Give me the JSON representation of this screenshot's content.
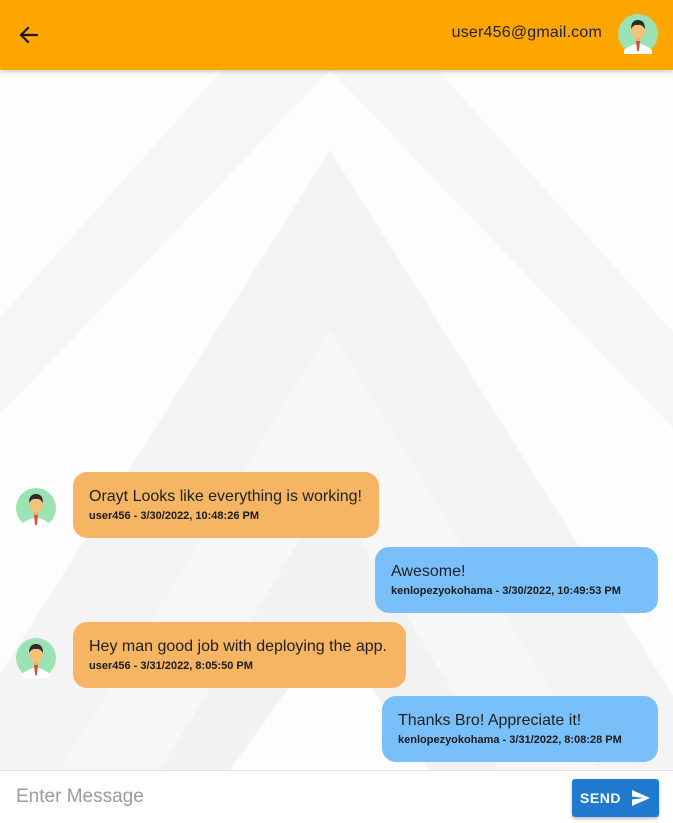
{
  "header": {
    "back_icon": "arrow-left-icon",
    "email": "user456@gmail.com",
    "avatar_icon": "user-avatar-icon",
    "background_color": "#ffa600"
  },
  "messages": [
    {
      "direction": "incoming",
      "text": "Orayt Looks like everything is working!",
      "meta": "user456 - 3/30/2022, 10:48:26 PM"
    },
    {
      "direction": "outgoing",
      "text": "Awesome!",
      "meta": "kenlopezyokohama - 3/30/2022, 10:49:53 PM"
    },
    {
      "direction": "incoming",
      "text": "Hey man good job with deploying the app.",
      "meta": "user456 - 3/31/2022, 8:05:50 PM"
    },
    {
      "direction": "outgoing",
      "text": "Thanks Bro! Appreciate it!",
      "meta": "kenlopezyokohama - 3/31/2022, 8:08:28 PM"
    }
  ],
  "composer": {
    "placeholder": "Enter Message",
    "value": "",
    "send_label": "SEND",
    "send_icon": "send-icon"
  },
  "colors": {
    "incoming_bubble": "#f5b562",
    "outgoing_bubble": "#79c0fb",
    "send_button": "#1f7ad0"
  }
}
